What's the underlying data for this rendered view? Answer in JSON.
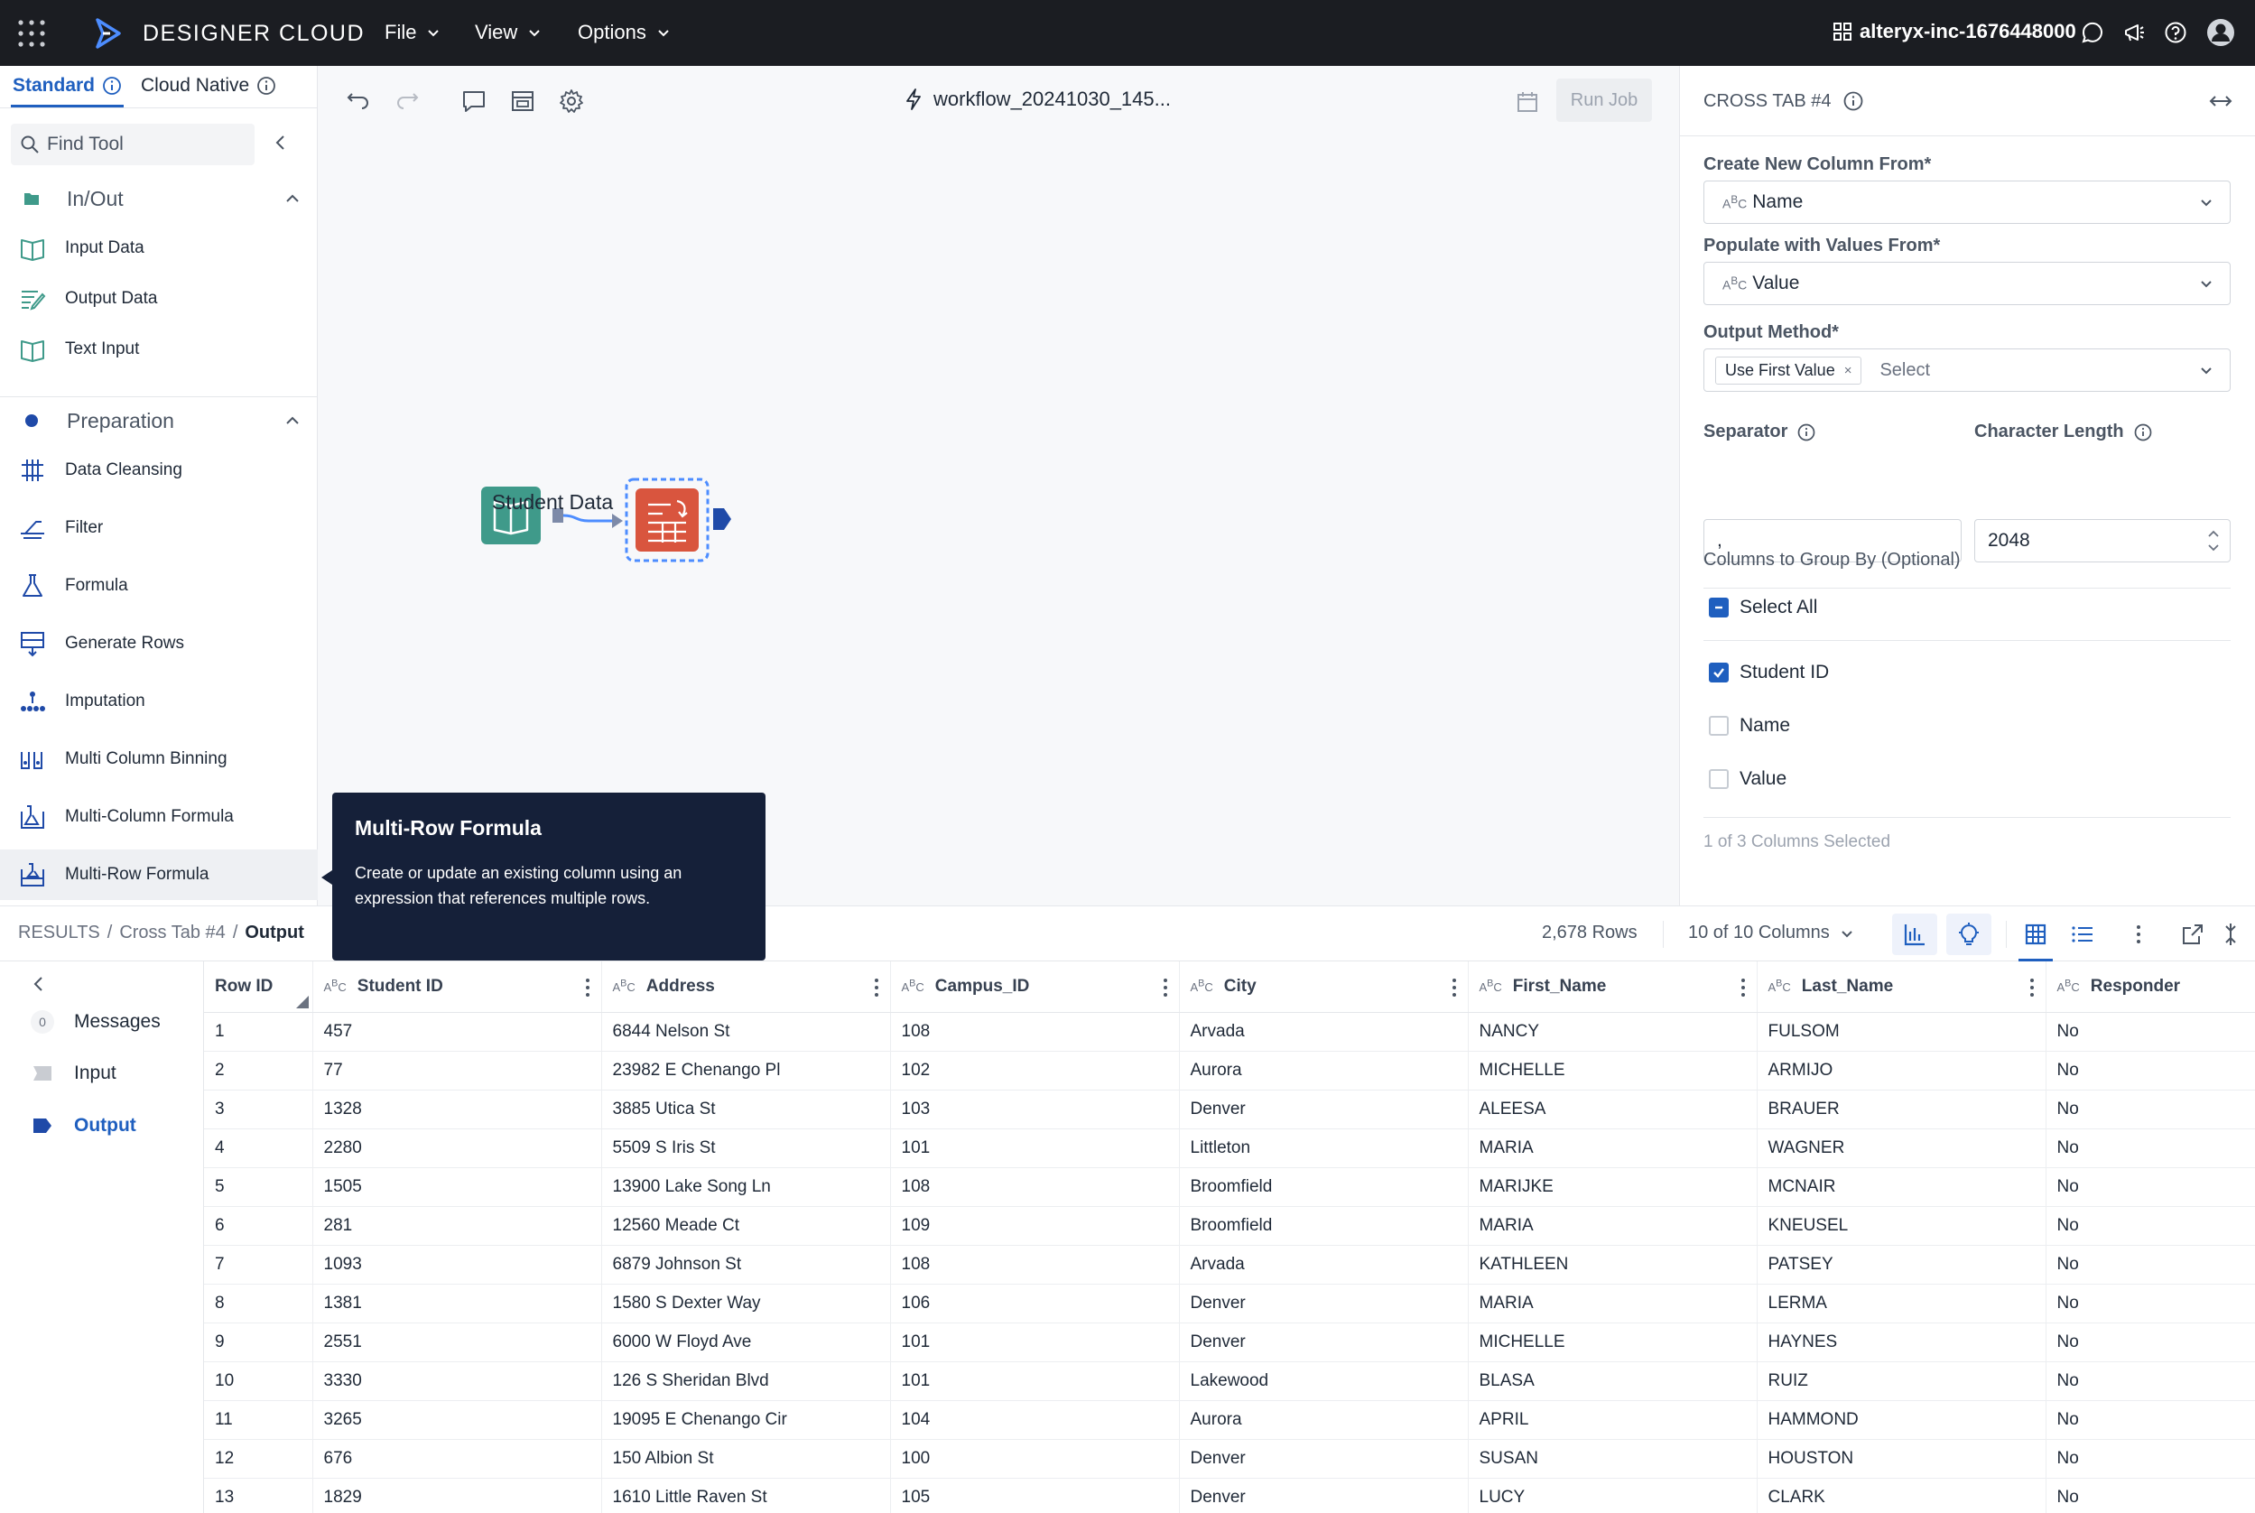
{
  "topbar": {
    "brand": "DESIGNER CLOUD",
    "menus": [
      "File",
      "View",
      "Options"
    ],
    "org": "alteryx-inc-1676448000"
  },
  "palette": {
    "tabs": [
      "Standard",
      "Cloud Native"
    ],
    "search_placeholder": "Find Tool",
    "categories": [
      {
        "name": "In/Out",
        "tools": [
          "Input Data",
          "Output Data",
          "Text Input"
        ]
      },
      {
        "name": "Preparation",
        "tools": [
          "Data Cleansing",
          "Filter",
          "Formula",
          "Generate Rows",
          "Imputation",
          "Multi Column Binning",
          "Multi-Column Formula",
          "Multi-Row Formula"
        ]
      }
    ]
  },
  "canvas": {
    "workflow_title": "workflow_20241030_145...",
    "run_label": "Run Job",
    "node_label": "Student Data"
  },
  "tooltip": {
    "title": "Multi-Row Formula",
    "body": "Create or update an existing column using an expression that references multiple rows."
  },
  "config": {
    "title": "CROSS TAB #4",
    "new_column_label": "Create New Column From*",
    "new_column_value": "Name",
    "populate_label": "Populate with Values From*",
    "populate_value": "Value",
    "output_method_label": "Output Method*",
    "output_method_chip": "Use First Value",
    "output_method_placeholder": "Select",
    "separator_label": "Separator",
    "separator_value": ",",
    "char_length_label": "Character Length",
    "char_length_value": "2048",
    "group_by_label": "Columns to Group By (Optional)",
    "select_all": "Select All",
    "columns": [
      {
        "name": "Student ID",
        "checked": true
      },
      {
        "name": "Name",
        "checked": false
      },
      {
        "name": "Value",
        "checked": false
      }
    ],
    "selected_count": "1 of 3 Columns Selected"
  },
  "results": {
    "crumb_root": "RESULTS",
    "crumb_mid": "Cross Tab #4",
    "crumb_leaf": "Output",
    "rows": "2,678 Rows",
    "columns": "10 of 10 Columns",
    "side": {
      "messages": "Messages",
      "messages_count": "0",
      "input": "Input",
      "output": "Output"
    }
  },
  "table": {
    "headers": [
      "Row ID",
      "Student ID",
      "Address",
      "Campus_ID",
      "City",
      "First_Name",
      "Last_Name",
      "Responder"
    ],
    "rows": [
      [
        "1",
        "457",
        "6844 Nelson St",
        "108",
        "Arvada",
        "NANCY",
        "FULSOM",
        "No"
      ],
      [
        "2",
        "77",
        "23982 E Chenango Pl",
        "102",
        "Aurora",
        "MICHELLE",
        "ARMIJO",
        "No"
      ],
      [
        "3",
        "1328",
        "3885 Utica St",
        "103",
        "Denver",
        "ALEESA",
        "BRAUER",
        "No"
      ],
      [
        "4",
        "2280",
        "5509 S Iris St",
        "101",
        "Littleton",
        "MARIA",
        "WAGNER",
        "No"
      ],
      [
        "5",
        "1505",
        "13900 Lake Song Ln",
        "108",
        "Broomfield",
        "MARIJKE",
        "MCNAIR",
        "No"
      ],
      [
        "6",
        "281",
        "12560 Meade Ct",
        "109",
        "Broomfield",
        "MARIA",
        "KNEUSEL",
        "No"
      ],
      [
        "7",
        "1093",
        "6879 Johnson St",
        "108",
        "Arvada",
        "KATHLEEN",
        "PATSEY",
        "No"
      ],
      [
        "8",
        "1381",
        "1580 S Dexter Way",
        "106",
        "Denver",
        "MARIA",
        "LERMA",
        "No"
      ],
      [
        "9",
        "2551",
        "6000 W Floyd Ave",
        "101",
        "Denver",
        "MICHELLE",
        "HAYNES",
        "No"
      ],
      [
        "10",
        "3330",
        "126 S Sheridan Blvd",
        "101",
        "Lakewood",
        "BLASA",
        "RUIZ",
        "No"
      ],
      [
        "11",
        "3265",
        "19095 E Chenango Cir",
        "104",
        "Aurora",
        "APRIL",
        "HAMMOND",
        "No"
      ],
      [
        "12",
        "676",
        "150 Albion St",
        "100",
        "Denver",
        "SUSAN",
        "HOUSTON",
        "No"
      ],
      [
        "13",
        "1829",
        "1610 Little Raven St",
        "105",
        "Denver",
        "LUCY",
        "CLARK",
        "No"
      ]
    ]
  }
}
